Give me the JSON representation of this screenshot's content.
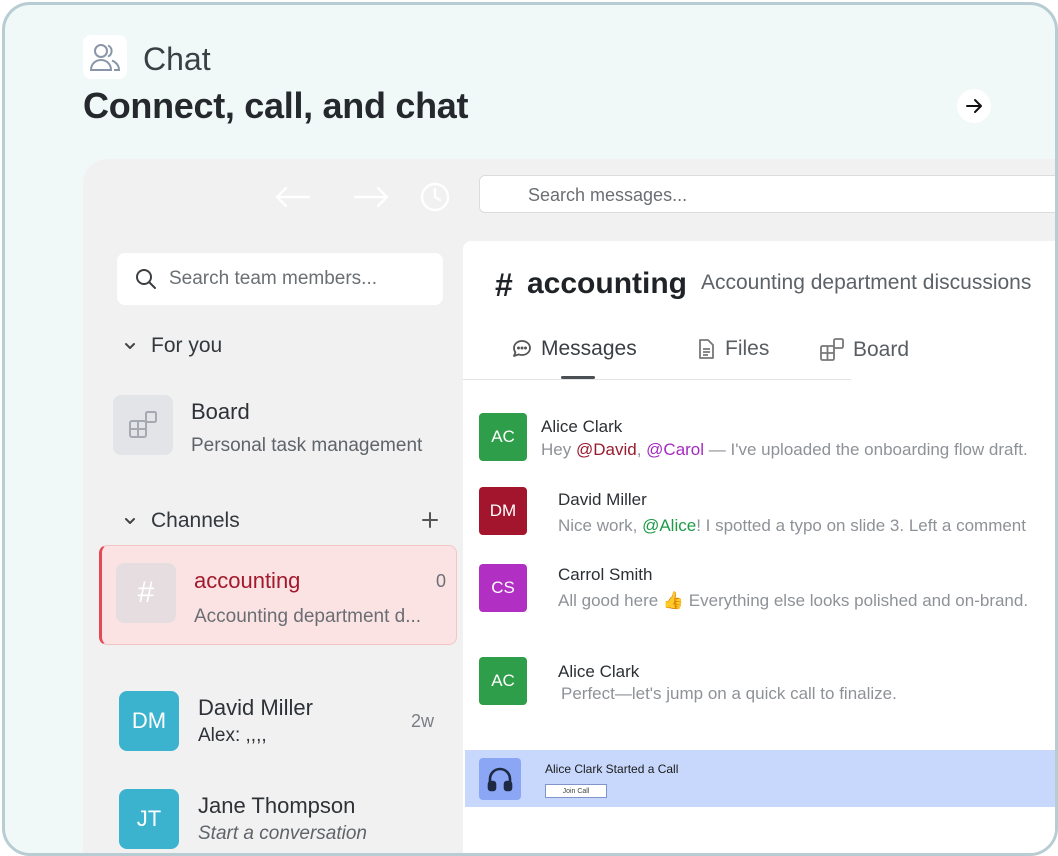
{
  "header": {
    "section_label": "Chat",
    "title": "Connect, call, and chat",
    "icon": "users-icon"
  },
  "toolbar": {
    "search_placeholder": "Search messages..."
  },
  "sidebar": {
    "search_placeholder": "Search team members...",
    "for_you_label": "For you",
    "board": {
      "title": "Board",
      "subtitle": "Personal task management"
    },
    "channels_label": "Channels",
    "channel": {
      "symbol": "#",
      "name": "accounting",
      "count": "0",
      "subtitle": "Accounting department d..."
    },
    "dms": [
      {
        "initials": "DM",
        "name": "David Miller",
        "preview": "Alex: ,,,,",
        "time": "2w",
        "color": "#3bb3cf"
      },
      {
        "initials": "JT",
        "name": "Jane Thompson",
        "preview": "Start a conversation",
        "time": "",
        "color": "#3bb3cf"
      }
    ]
  },
  "main": {
    "channel_hash": "#",
    "channel_name": "accounting",
    "channel_description": "Accounting department discussions",
    "tabs": [
      {
        "label": "Messages",
        "icon": "message-icon",
        "active": true
      },
      {
        "label": "Files",
        "icon": "file-icon",
        "active": false
      },
      {
        "label": "Board",
        "icon": "board-icon",
        "active": false
      }
    ],
    "messages": [
      {
        "initials": "AC",
        "author": "Alice Clark",
        "color": "#2f9e4a",
        "prefix": "Hey ",
        "mention1": "@David",
        "sep": ", ",
        "mention2": "@Carol",
        "suffix": " — I've uploaded the onboarding flow draft."
      },
      {
        "initials": "DM",
        "author": "David Miller",
        "color": "#a3152c",
        "prefix": "Nice work, ",
        "mention1": "@Alice",
        "suffix": "! I spotted a typo on slide 3. Left a comment"
      },
      {
        "initials": "CS",
        "author": "Carrol Smith",
        "color": "#b22fc4",
        "text": "All good here 👍 Everything else looks polished and on-brand."
      },
      {
        "initials": "AC",
        "author": "Alice Clark",
        "color": "#2f9e4a",
        "text": "Perfect—let's jump on a quick call to finalize."
      }
    ],
    "call": {
      "text": "Alice Clark Started a Call",
      "button": "Join Call",
      "icon": "headphones-icon"
    }
  },
  "colors": {
    "accent_red": "#e24a55",
    "selected_bg": "#fbe3e4",
    "call_bg": "#c7d8fc"
  }
}
